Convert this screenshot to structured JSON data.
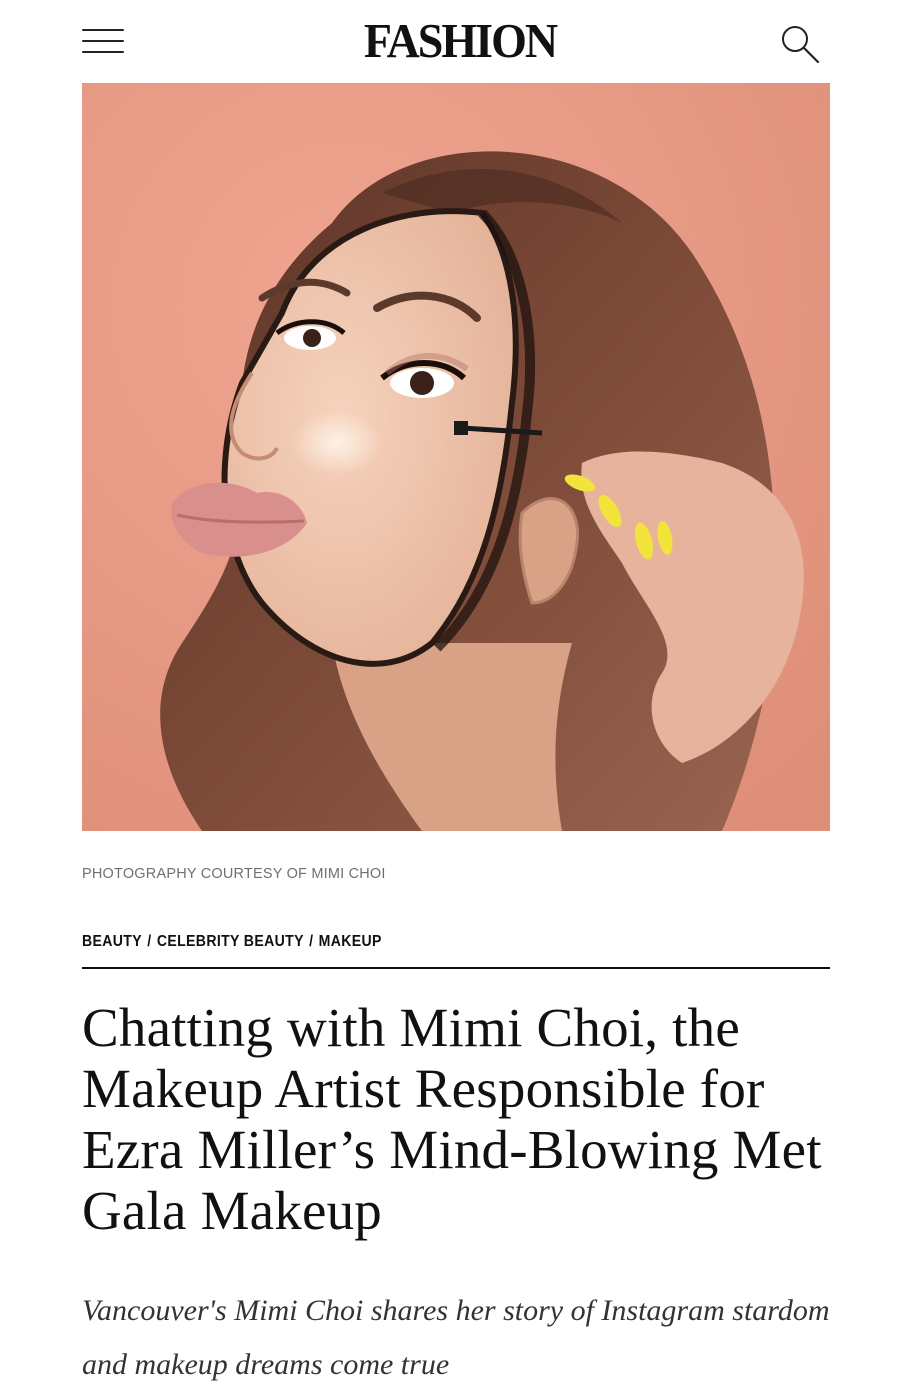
{
  "header": {
    "logo": "FASHION",
    "menu_icon": "hamburger-menu-icon",
    "search_icon": "search-icon"
  },
  "hero": {
    "photo_credit": "PHOTOGRAPHY COURTESY OF MIMI CHOI"
  },
  "breadcrumb": {
    "items": [
      "BEAUTY",
      "CELEBRITY BEAUTY",
      "MAKEUP"
    ],
    "separator": "/"
  },
  "article": {
    "headline": "Chatting with Mimi Choi, the Makeup Artist Responsible for Ezra Miller’s Mind-Blowing Met Gala Makeup",
    "dek": "Vancouver's Mimi Choi shares her story of Instagram stardom and makeup dreams come true"
  },
  "colors": {
    "background": "#ffffff",
    "text": "#111111",
    "credit_text": "#707070",
    "photo_backdrop": "#e89a84"
  }
}
